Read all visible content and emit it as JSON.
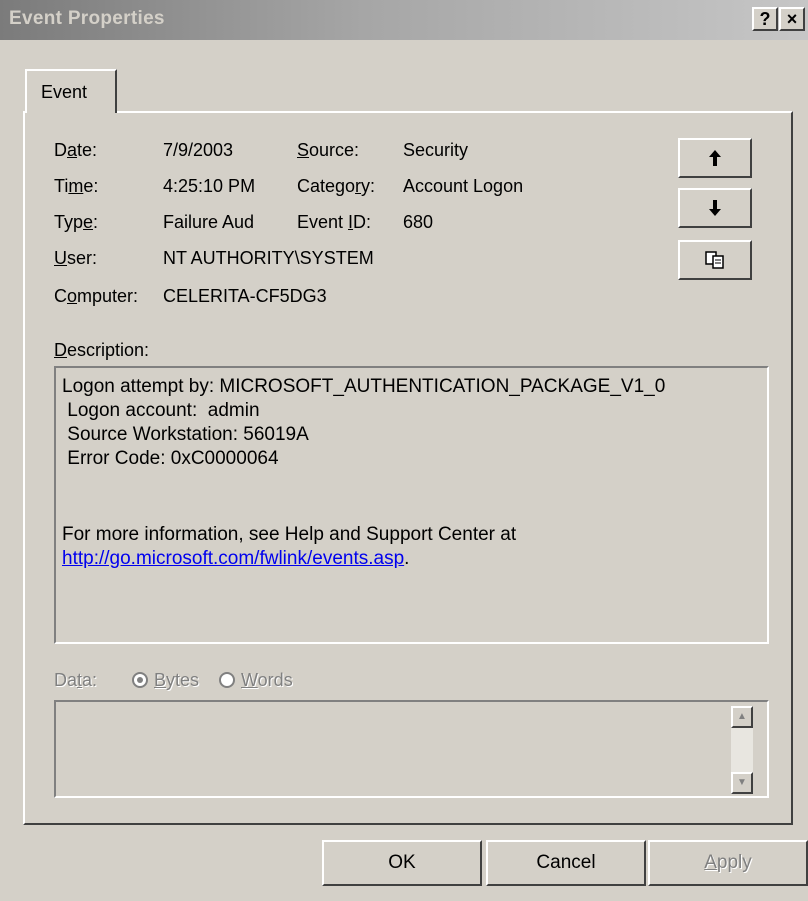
{
  "window": {
    "title": "Event Properties",
    "help_glyph": "?",
    "close_glyph": "×"
  },
  "tabs": [
    {
      "label": "Event"
    }
  ],
  "fields": {
    "date": {
      "label_pre": "D",
      "label_u": "a",
      "label_post": "te:",
      "value": "7/9/2003"
    },
    "time": {
      "label_pre": "Ti",
      "label_u": "m",
      "label_post": "e:",
      "value": "4:25:10 PM"
    },
    "type": {
      "label_pre": "Typ",
      "label_u": "e",
      "label_post": ":",
      "value": "Failure Aud"
    },
    "user": {
      "label_pre": "",
      "label_u": "U",
      "label_post": "ser:",
      "value": "NT AUTHORITY\\SYSTEM"
    },
    "computer": {
      "label_pre": "C",
      "label_u": "o",
      "label_post": "mputer:",
      "value": "CELERITA-CF5DG3"
    },
    "source": {
      "label_pre": "",
      "label_u": "S",
      "label_post": "ource:",
      "value": "Security"
    },
    "category": {
      "label_pre": "Catego",
      "label_u": "r",
      "label_post": "y:",
      "value": "Account Logon"
    },
    "event_id": {
      "label_pre": "Event ",
      "label_u": "I",
      "label_post": "D:",
      "value": "680"
    }
  },
  "side_buttons": {
    "up_icon": "arrow-up-icon",
    "down_icon": "arrow-down-icon",
    "copy_icon": "copy-icon"
  },
  "description": {
    "label_u": "D",
    "label_post": "escription:",
    "lines": [
      "Logon attempt by: MICROSOFT_AUTHENTICATION_PACKAGE_V1_0",
      " Logon account:  admin",
      " Source Workstation: 56019A",
      " Error Code: 0xC0000064",
      "For more information, see Help and Support Center at"
    ],
    "link": "http://go.microsoft.com/fwlink/events.asp",
    "link_suffix": "."
  },
  "data": {
    "label_pre": "Da",
    "label_u": "t",
    "label_post": "a:",
    "bytes_u": "B",
    "bytes_post": "ytes",
    "words_u": "W",
    "words_post": "ords",
    "selected": "Bytes"
  },
  "footer": {
    "ok": "OK",
    "cancel": "Cancel",
    "apply_u": "A",
    "apply_post": "pply"
  },
  "colors": {
    "face": "#d4d0c8",
    "link": "#0000ee",
    "disabled": "#808080"
  }
}
